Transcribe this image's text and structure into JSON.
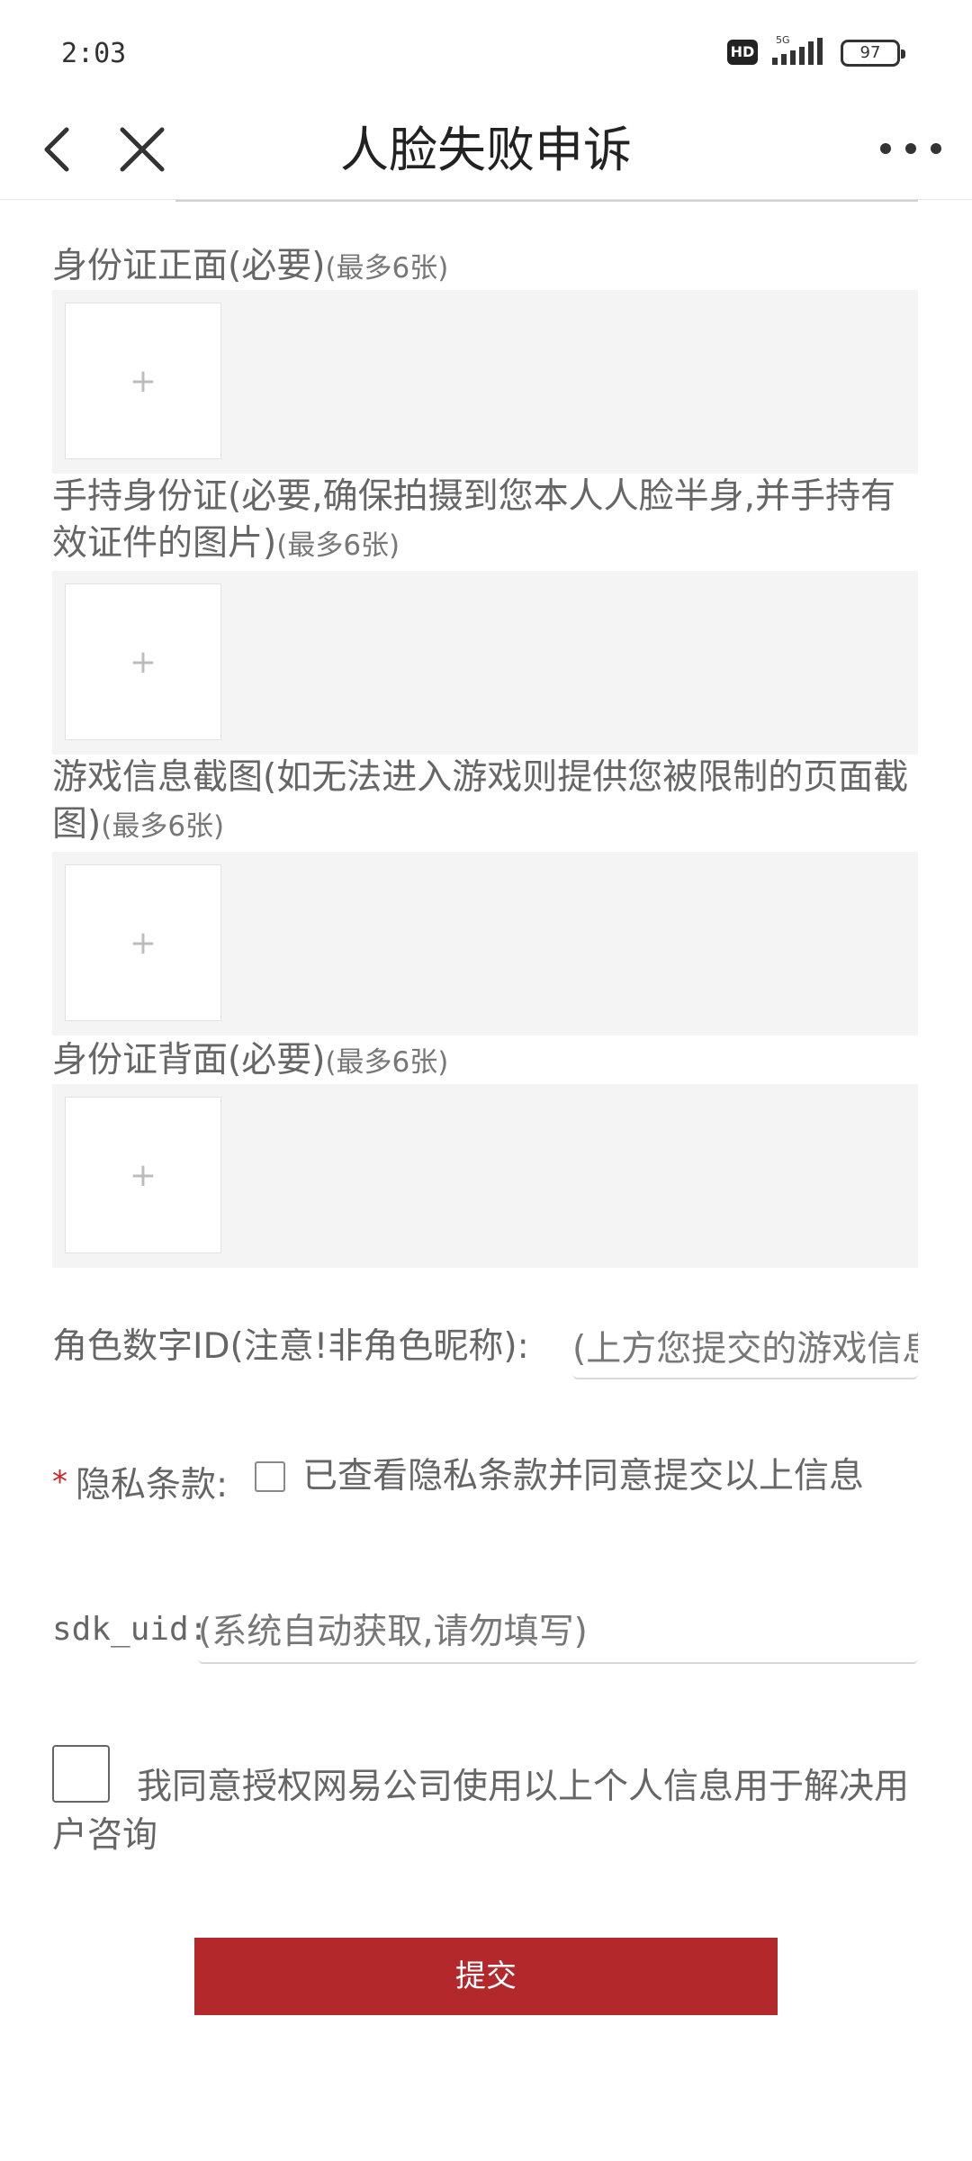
{
  "status_bar": {
    "time": "2:03",
    "network": "HD",
    "signal_label": "5G",
    "battery": "97"
  },
  "nav": {
    "title": "人脸失败申诉"
  },
  "upload_sections": [
    {
      "label": "身份证正面(必要)",
      "hint": "(最多6张)",
      "add_glyph": "+"
    },
    {
      "label": "手持身份证(必要,确保拍摄到您本人人脸半身,并手持有效证件的图片)",
      "hint": "(最多6张)",
      "add_glyph": "+"
    },
    {
      "label": "游戏信息截图(如无法进入游戏则提供您被限制的页面截图)",
      "hint": "(最多6张)",
      "add_glyph": "+"
    },
    {
      "label": "身份证背面(必要)",
      "hint": "(最多6张)",
      "add_glyph": "+"
    }
  ],
  "role_id": {
    "label": "角色数字ID(注意!非角色昵称):",
    "placeholder": "(上方您提交的游戏信息截图中的角色数字ID)"
  },
  "privacy": {
    "required_mark": "*",
    "label": "隐私条款:",
    "checkbox_text": "已查看隐私条款并同意提交以上信息"
  },
  "sdk_uid": {
    "label": "sdk_uid:",
    "placeholder": "(系统自动获取,请勿填写)"
  },
  "consent": {
    "text": "我同意授权网易公司使用以上个人信息用于解决用户咨询"
  },
  "submit": {
    "label": "提交",
    "color": "#b2282b"
  }
}
